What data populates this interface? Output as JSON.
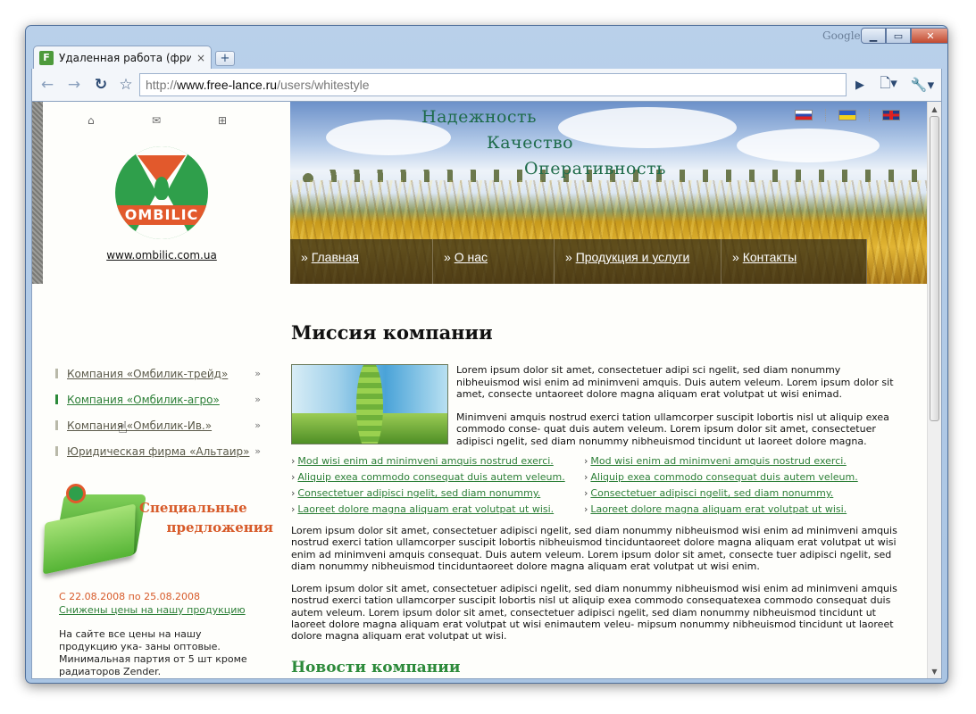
{
  "browser": {
    "brand": "Google",
    "controls": {
      "minimize": "▁",
      "maximize": "▭",
      "close": "✕"
    },
    "tab": {
      "favicon_letter": "F",
      "title": "Удаленная работа (фри...",
      "close": "×"
    },
    "new_tab": "+",
    "address": {
      "scheme": "http://",
      "domain": "www.free-lance.ru",
      "path": "/users/whitestyle"
    },
    "icons": {
      "back": "back-arrow-icon",
      "forward": "forward-arrow-icon",
      "reload": "reload-icon",
      "star": "star-icon",
      "page": "page-icon",
      "wrench": "wrench-icon"
    }
  },
  "site": {
    "header_icons": [
      "home-icon",
      "mail-icon",
      "sitemap-icon"
    ],
    "logo_text": "OMBILIC",
    "site_url": "www.ombilic.com.ua",
    "slogans": [
      "Надежность",
      "Качество",
      "Оперативность"
    ],
    "flags": [
      "ru",
      "ua",
      "gb"
    ],
    "nav": [
      {
        "label": "Главная"
      },
      {
        "label": "О нас"
      },
      {
        "label": "Продукция и услуги"
      },
      {
        "label": "Контакты"
      }
    ],
    "menu": [
      {
        "label": "Компания «Омбилик-трейд»",
        "active": false
      },
      {
        "label": "Компания «Омбилик-агро»",
        "active": true
      },
      {
        "label": "Компания «Омбилик-Ив.»",
        "active": false
      },
      {
        "label": "Юридическая фирма «Альтаир»",
        "active": false
      }
    ],
    "menu_arrow": "»",
    "special": {
      "line1": "Специальные",
      "line2": "предложения"
    },
    "promo": {
      "date": "С 22.08.2008 по 25.08.2008",
      "link": "Снижены цены на нашу продукцию",
      "text": "На сайте все цены на нашу продукцию ука- заны оптовые. Минимальная партия от 5 шт кроме радиаторов Zender."
    },
    "main": {
      "title": "Миссия компании",
      "intro_p1": "Lorem ipsum dolor sit amet, consectetuer adipi sci ngelit, sed diam nonummy nibheuismod wisi enim ad minimveni amquis. Duis autem veleum. Lorem ipsum dolor sit amet, consecte untaoreet dolore magna aliquam erat volutpat ut wisi enimad.",
      "intro_p2": "Minimveni amquis nostrud exerci tation ullamcorper suscipit lobortis nisl ut aliquip exea commodo conse- quat duis autem veleum. Lorem ipsum dolor sit amet, consectetuer adipisci ngelit, sed diam nonummy nibheuismod tincidunt ut laoreet dolore magna.",
      "links_left": [
        "Mod wisi enim ad minimveni amquis nostrud exerci.",
        "Aliquip exea commodo consequat duis autem veleum.",
        "Consectetuer adipisci ngelit, sed diam nonummy.",
        "Laoreet dolore magna aliquam erat volutpat ut wisi."
      ],
      "links_right": [
        "Mod wisi enim ad minimveni amquis nostrud exerci.",
        "Aliquip exea commodo consequat duis autem veleum.",
        "Consectetuer adipisci ngelit, sed diam nonummy.",
        "Laoreet dolore magna aliquam erat volutpat ut wisi."
      ],
      "link_bullet": "›",
      "body_p1": "Lorem ipsum dolor sit amet, consectetuer adipisci ngelit, sed diam nonummy nibheuismod wisi enim ad minimveni amquis nostrud exerci tation ullamcorper suscipit lobortis nibheuismod tinciduntaoreet dolore magna aliquam erat volutpat ut wisi enim ad minimveni amquis consequat. Duis autem veleum. Lorem ipsum dolor sit amet, consecte tuer adipisci ngelit, sed diam nonummy nibheuismod tinciduntaoreet dolore magna aliquam erat volutpat ut wisi enim.",
      "body_p2": "Lorem ipsum dolor sit amet, consectetuer adipisci ngelit, sed diam nonummy nibheuismod wisi enim ad minimveni amquis nostrud exerci tation ullamcorper suscipit lobortis nisl ut aliquip exea commodo consequatexea commodo consequat duis autem veleum. Lorem ipsum dolor sit amet, consectetuer adipisci ngelit, sed diam nonummy nibheuismod tincidunt ut laoreet dolore magna aliquam erat volutpat ut wisi enimautem veleu- mipsum nonummy nibheuismod tincidunt ut laoreet dolore magna aliquam erat volutpat ut wisi.",
      "news_title": "Новости компании"
    }
  }
}
